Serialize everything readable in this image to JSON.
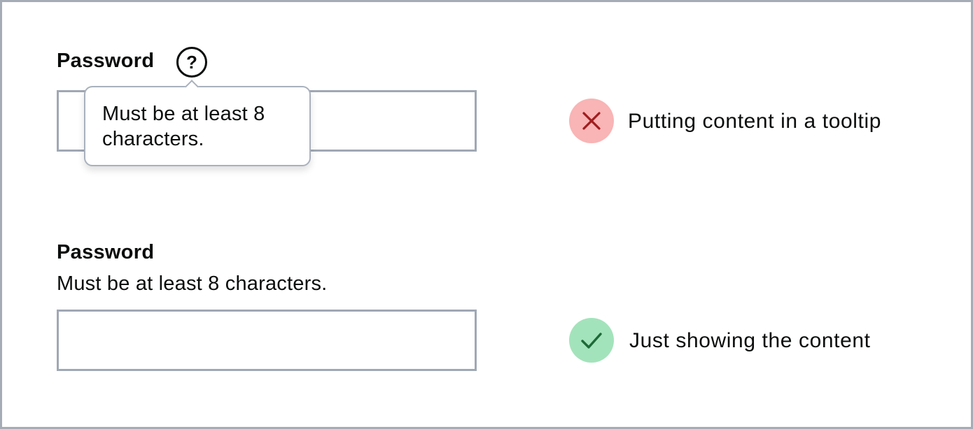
{
  "example_bad": {
    "field_label": "Password",
    "help_icon_glyph": "?",
    "tooltip_text": "Must be at least 8 characters.",
    "status_icon": "cross-icon",
    "status_color": "#f9b4b5",
    "status_icon_color": "#a01d1f",
    "caption": "Putting content in a tooltip"
  },
  "example_good": {
    "field_label": "Password",
    "hint_text": "Must be at least 8 characters.",
    "status_icon": "check-icon",
    "status_color": "#a3e3bb",
    "status_icon_color": "#1c6a37",
    "caption": "Just showing the content"
  }
}
